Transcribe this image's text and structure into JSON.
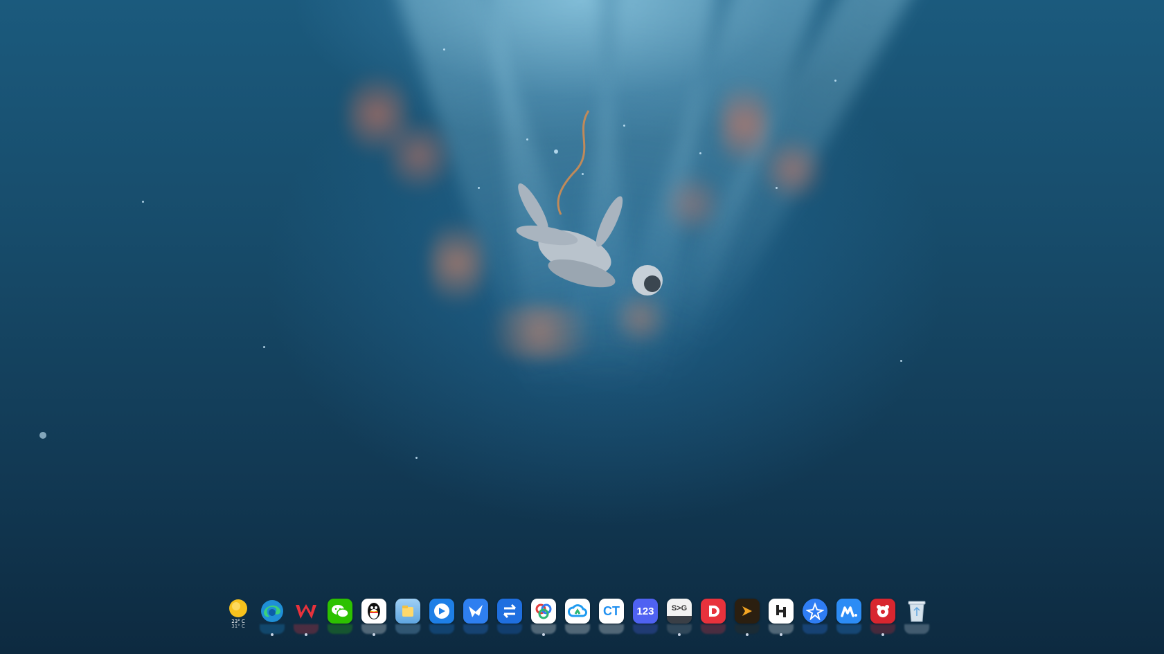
{
  "desktop": {
    "wallpaper": "astronaut-floating-in-blue-nebula"
  },
  "dock": {
    "weather": {
      "icon": "weather-sunny-icon",
      "temp_high": "23° C",
      "temp_low": "31° C"
    },
    "apps": [
      {
        "name": "edge",
        "icon": "edge-icon",
        "color": "#1f8fd6"
      },
      {
        "name": "wps",
        "icon": "wps-icon",
        "color": "#ffffff",
        "glyph": "W"
      },
      {
        "name": "wechat",
        "icon": "wechat-icon",
        "color": "#2dc100"
      },
      {
        "name": "qq",
        "icon": "qq-penguin-icon",
        "color": "#ffffff"
      },
      {
        "name": "folder",
        "icon": "folder-icon",
        "color": "#8cc4f0"
      },
      {
        "name": "blue-circle-app",
        "icon": "blue-circle-icon",
        "color": "#1e7fe6"
      },
      {
        "name": "feishu",
        "icon": "bird-icon",
        "color": "#2e7ff0"
      },
      {
        "name": "transfer",
        "icon": "transfer-arrows-icon",
        "color": "#1f6fe0"
      },
      {
        "name": "baidu-netdisk",
        "icon": "netdisk-icon",
        "color": "#ffffff"
      },
      {
        "name": "cloud-app",
        "icon": "cloud-icon",
        "color": "#ffffff"
      },
      {
        "name": "ct-app",
        "icon": "ct-icon",
        "color": "#ffffff",
        "glyph": "CT"
      },
      {
        "name": "123-pan",
        "icon": "123-icon",
        "color": "#4f62f2",
        "glyph": "123"
      },
      {
        "name": "terminal",
        "icon": "terminal-icon",
        "color": "#2b2f35",
        "glyph": "S>G"
      },
      {
        "name": "red-app",
        "icon": "red-d-icon",
        "color": "#e8323c"
      },
      {
        "name": "potplayer",
        "icon": "play-icon",
        "color": "#2b1f10"
      },
      {
        "name": "h-app",
        "icon": "h-logo-icon",
        "color": "#ffffff"
      },
      {
        "name": "xunlei",
        "icon": "xunlei-bird-icon",
        "color": "#2f7df4"
      },
      {
        "name": "m-app",
        "icon": "m-logo-icon",
        "color": "#2c8cf5"
      },
      {
        "name": "red-bear-app",
        "icon": "bear-icon",
        "color": "#d8262f"
      },
      {
        "name": "recycle-bin",
        "icon": "recycle-bin-icon",
        "color": "#c8d6e2"
      }
    ]
  }
}
